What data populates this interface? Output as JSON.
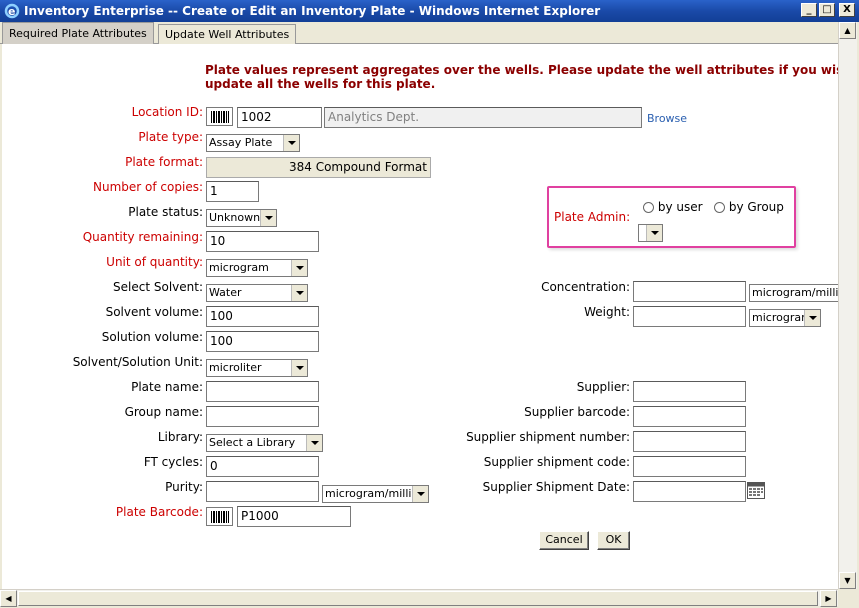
{
  "window": {
    "title": "Inventory Enterprise -- Create or Edit an Inventory Plate - Windows Internet Explorer",
    "minimize": "_",
    "maximize": "□",
    "close": "X"
  },
  "tabs": [
    {
      "label": "Required Plate Attributes",
      "active": true
    },
    {
      "label": "Update Well Attributes",
      "active": false
    }
  ],
  "notice": {
    "line1": "Plate values represent aggregates over the wells. Please update the well attributes if you wish t",
    "line2": "update all the wells for this plate."
  },
  "form": {
    "location_id": {
      "label": "Location ID:",
      "value": "1002",
      "location_name": "Analytics Dept.",
      "browse": "Browse"
    },
    "plate_type": {
      "label": "Plate type:",
      "selected": "Assay Plate"
    },
    "plate_format": {
      "label": "Plate format:",
      "value": "384 Compound Format"
    },
    "number_of_copies": {
      "label": "Number of copies:",
      "value": "1"
    },
    "plate_status": {
      "label": "Plate status:",
      "selected": "Unknown"
    },
    "quantity_remaining": {
      "label": "Quantity remaining:",
      "value": "10"
    },
    "unit_of_quantity": {
      "label": "Unit of quantity:",
      "selected": "microgram"
    },
    "select_solvent": {
      "label": "Select Solvent:",
      "selected": "Water"
    },
    "solvent_volume": {
      "label": "Solvent volume:",
      "value": "100"
    },
    "solution_volume": {
      "label": "Solution volume:",
      "value": "100"
    },
    "solvent_solution_unit": {
      "label": "Solvent/Solution Unit:",
      "selected": "microliter"
    },
    "plate_name": {
      "label": "Plate name:",
      "value": ""
    },
    "group_name": {
      "label": "Group name:",
      "value": ""
    },
    "library": {
      "label": "Library:",
      "selected": "Select a Library"
    },
    "ft_cycles": {
      "label": "FT cycles:",
      "value": "0"
    },
    "purity": {
      "label": "Purity:",
      "value": "",
      "unit": "microgram/milliliter"
    },
    "plate_barcode": {
      "label": "Plate Barcode:",
      "value": "P1000"
    },
    "plate_admin": {
      "label": "Plate Admin:",
      "by_user": "by user",
      "by_group": "by Group",
      "selected": ""
    },
    "concentration": {
      "label": "Concentration:",
      "value": "",
      "unit": "microgram/milliliter"
    },
    "weight": {
      "label": "Weight:",
      "value": "",
      "unit": "microgram"
    },
    "supplier": {
      "label": "Supplier:",
      "value": ""
    },
    "supplier_barcode": {
      "label": "Supplier barcode:",
      "value": ""
    },
    "supplier_shipment_number": {
      "label": "Supplier shipment number:",
      "value": ""
    },
    "supplier_shipment_code": {
      "label": "Supplier shipment code:",
      "value": ""
    },
    "supplier_shipment_date": {
      "label": "Supplier Shipment Date:",
      "value": ""
    }
  },
  "buttons": {
    "cancel": "Cancel",
    "ok": "OK"
  },
  "colors": {
    "required_label": "#cc0000",
    "notice": "#8b0000",
    "highlight_border": "#e040a0",
    "link": "#2a5fb0"
  }
}
